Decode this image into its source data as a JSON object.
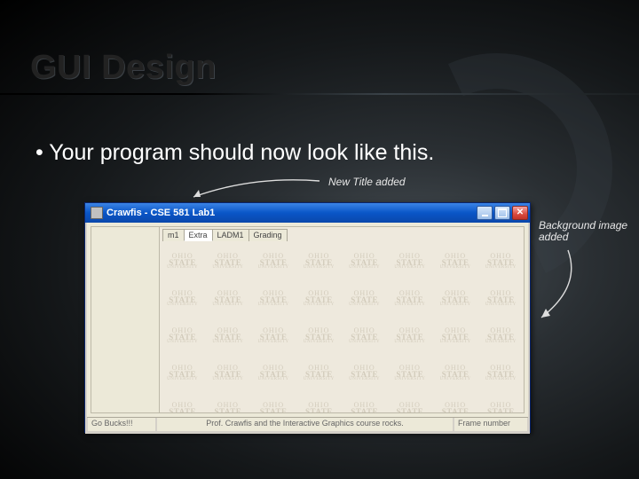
{
  "slide": {
    "title": "GUI Design",
    "bullet": "• Your program should now look like this.",
    "annot_title": "New Title added",
    "annot_bg": "Background image added"
  },
  "window": {
    "title": "Crawfis - CSE 581 Lab1",
    "tabs": [
      "m1",
      "Extra",
      "LADM1",
      "Grading"
    ],
    "status": {
      "left": "Go Bucks!!!",
      "center": "Prof. Crawfis and the Interactive Graphics course rocks.",
      "right": "Frame number"
    },
    "bg_logo": {
      "line1": "OHIO",
      "line2": "STATE",
      "line3": "UNIVERSITY"
    }
  }
}
